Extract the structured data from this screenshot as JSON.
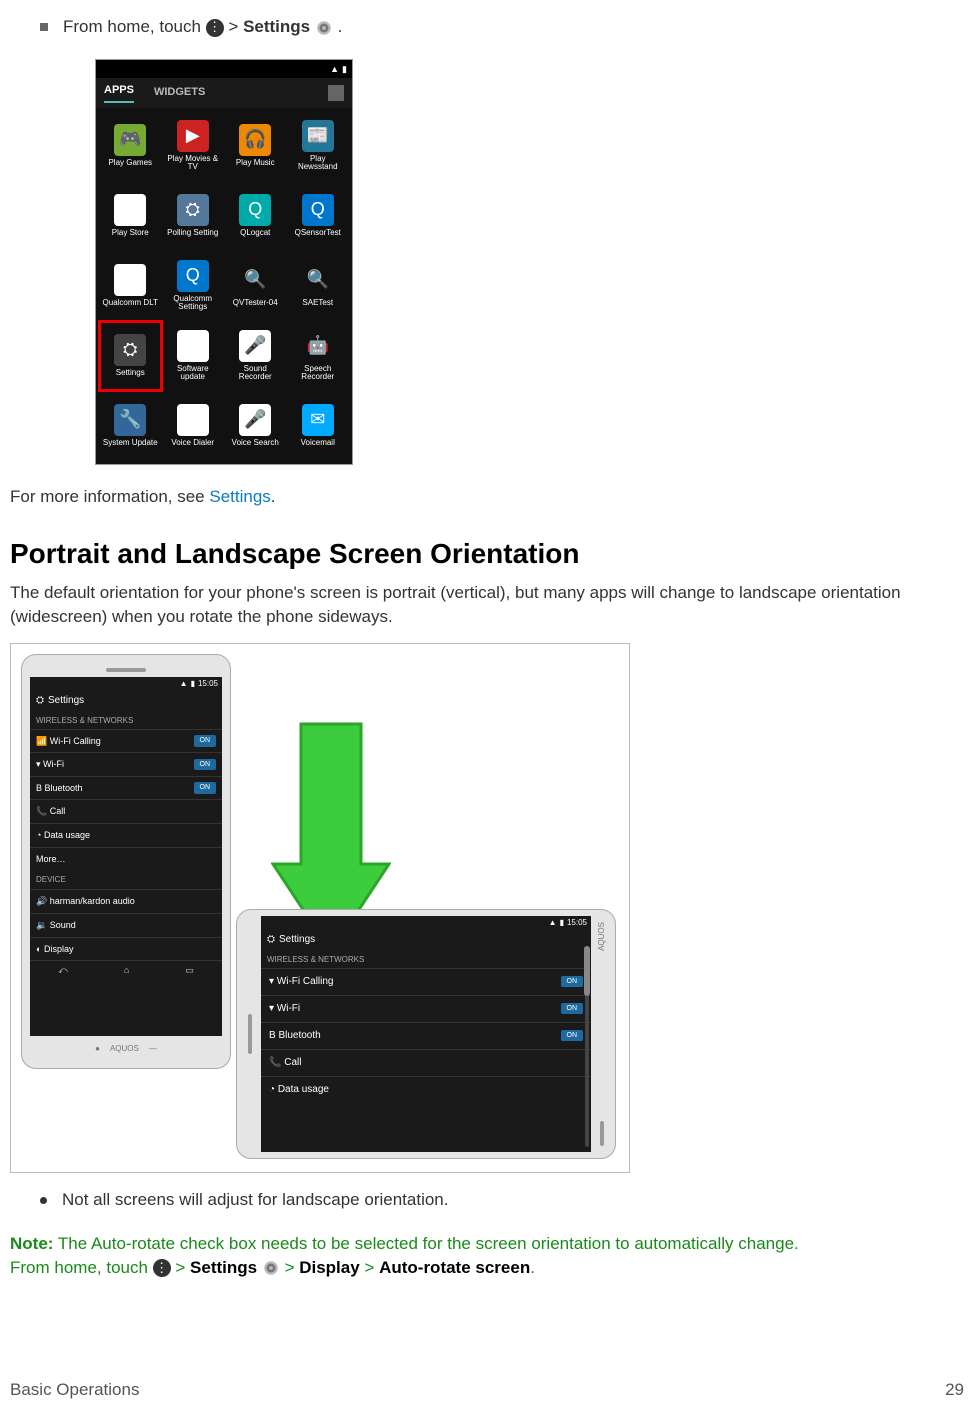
{
  "intro": {
    "bullet_pre": "From home, touch ",
    "gt": " > ",
    "settings_bold": "Settings",
    "period": " ."
  },
  "phone1": {
    "statusbar": {
      "batt": "▮"
    },
    "tabs": {
      "apps": "APPS",
      "widgets": "WIDGETS"
    },
    "apps": [
      {
        "label": "Play Games",
        "ico": "🎮",
        "bg": "#7a3"
      },
      {
        "label": "Play Movies & TV",
        "ico": "▶",
        "bg": "#c22"
      },
      {
        "label": "Play Music",
        "ico": "🎧",
        "bg": "#e80"
      },
      {
        "label": "Play Newsstand",
        "ico": "📰",
        "bg": "#279"
      },
      {
        "label": "Play Store",
        "ico": "▶",
        "bg": "#fff"
      },
      {
        "label": "Polling Setting",
        "ico": "⛭",
        "bg": "#579"
      },
      {
        "label": "QLogcat",
        "ico": "Q",
        "bg": "#0aa"
      },
      {
        "label": "QSensorTest",
        "ico": "Q",
        "bg": "#07c"
      },
      {
        "label": "Qualcomm DLT",
        "ico": "◧",
        "bg": "#fff"
      },
      {
        "label": "Qualcomm Settings",
        "ico": "Q",
        "bg": "#07c"
      },
      {
        "label": "QVTester-04",
        "ico": "🔍",
        "bg": ""
      },
      {
        "label": "SAETest",
        "ico": "🔍",
        "bg": ""
      },
      {
        "label": "Settings",
        "ico": "⛭",
        "bg": "#444",
        "hi": true
      },
      {
        "label": "Software update",
        "ico": "⛭",
        "bg": "#fff"
      },
      {
        "label": "Sound Recorder",
        "ico": "🎤",
        "bg": "#fff"
      },
      {
        "label": "Speech Recorder",
        "ico": "🤖",
        "bg": ""
      },
      {
        "label": "System Update",
        "ico": "🔧",
        "bg": "#369"
      },
      {
        "label": "Voice Dialer",
        "ico": "🗣",
        "bg": "#fff"
      },
      {
        "label": "Voice Search",
        "ico": "🎤",
        "bg": "#fff"
      },
      {
        "label": "Voicemail",
        "ico": "✉",
        "bg": "#0af"
      }
    ]
  },
  "moreinfo": {
    "pre": "For more information, see ",
    "link": "Settings",
    "post": "."
  },
  "heading": "Portrait and Landscape Screen Orientation",
  "para": "The default orientation for your phone's screen is portrait (vertical), but many apps will change to landscape orientation (widescreen) when you rotate the phone sideways.",
  "portrait": {
    "time": "15:05",
    "title": "Settings",
    "header": "WIRELESS & NETWORKS",
    "rows": [
      {
        "icon": "📶",
        "label": "Wi-Fi Calling",
        "on": "ON"
      },
      {
        "icon": "▾",
        "label": "Wi-Fi",
        "on": "ON"
      },
      {
        "icon": "B",
        "label": "Bluetooth",
        "on": "ON"
      },
      {
        "icon": "📞",
        "label": "Call",
        "on": ""
      },
      {
        "icon": "◔",
        "label": "Data usage",
        "on": ""
      },
      {
        "icon": "",
        "label": "More…",
        "on": ""
      }
    ],
    "sect2": "DEVICE",
    "rows2": [
      {
        "icon": "🔊",
        "label": "harman/kardon audio"
      },
      {
        "icon": "🔉",
        "label": "Sound"
      },
      {
        "icon": "◐",
        "label": "Display"
      }
    ],
    "brand": "AQUOS"
  },
  "land": {
    "time": "15:05",
    "title": "Settings",
    "header": "WIRELESS & NETWORKS",
    "rows": [
      {
        "icon": "▾",
        "label": "Wi-Fi Calling",
        "on": "ON"
      },
      {
        "icon": "▾",
        "label": "Wi-Fi",
        "on": "ON"
      },
      {
        "icon": "B",
        "label": "Bluetooth",
        "on": "ON"
      },
      {
        "icon": "📞",
        "label": "Call",
        "on": ""
      },
      {
        "icon": "◔",
        "label": "Data usage",
        "on": ""
      }
    ],
    "brand": "AQUOS"
  },
  "bullet2": "Not all screens will adjust for landscape orientation.",
  "note": {
    "label": "Note:",
    "text1": " The Auto-rotate check box needs to be selected for the screen orientation to automatically change. ",
    "text2_pre": "From home, touch ",
    "gt": " > ",
    "settings": "Settings",
    "display": "Display",
    "autorotate": "Auto-rotate screen",
    "period": "."
  },
  "footer": {
    "left": "Basic Operations",
    "right": "29"
  }
}
